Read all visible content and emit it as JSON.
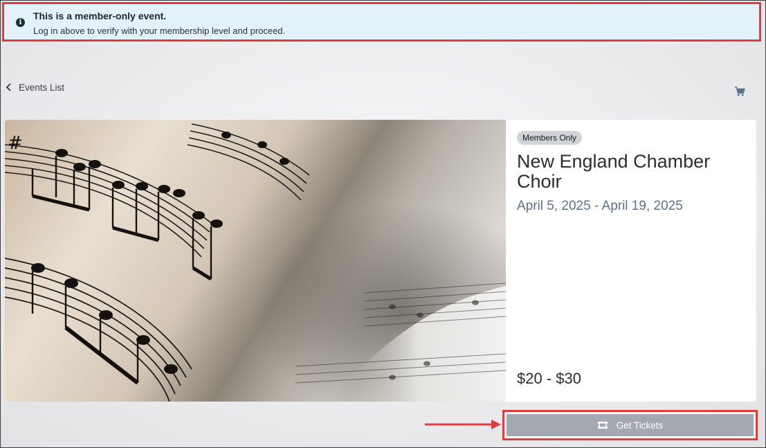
{
  "alert": {
    "icon": "info-icon",
    "title": "This is a member-only event.",
    "text": "Log in above to verify with your membership level and proceed."
  },
  "nav": {
    "back_label": "Events List",
    "back_icon": "chevron-left-icon",
    "cart_icon": "cart-icon"
  },
  "event": {
    "badge": "Members Only",
    "title": "New England Chamber Choir",
    "dates": "April 5, 2025 - April 19, 2025",
    "price": "$20 - $30",
    "image": "sheet-music-image"
  },
  "cta": {
    "label": "Get Tickets",
    "icon": "ticket-icon"
  },
  "colors": {
    "alert_bg": "#e3f1fb",
    "highlight": "#e23b3b",
    "date_text": "#5d6f8f",
    "button_bg": "#a4a8b0"
  }
}
